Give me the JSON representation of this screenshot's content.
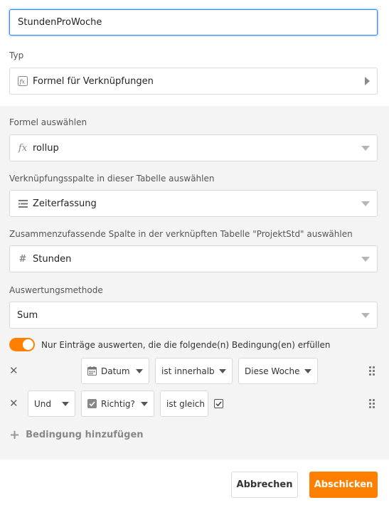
{
  "column_name": {
    "value": "StundenProWoche"
  },
  "type": {
    "label": "Typ",
    "value": "Formel für Verknüpfungen",
    "icon": "fx-icon"
  },
  "formula": {
    "label": "Formel auswählen",
    "value": "rollup",
    "icon": "fx-icon"
  },
  "link_column": {
    "label": "Verknüpfungsspalte in dieser Tabelle auswählen",
    "value": "Zeiterfassung",
    "icon": "link-list-icon"
  },
  "summary_column": {
    "label": "Zusammenzufassende Spalte in der verknüpften Tabelle \"ProjektStd\" auswählen",
    "value": "Stunden",
    "icon": "hash-icon"
  },
  "method": {
    "label": "Auswertungsmethode",
    "value": "Sum"
  },
  "filter_toggle": {
    "label": "Nur Einträge auswerten, die die folgende(n) Bedingung(en) erfüllen",
    "on": true
  },
  "conditions": [
    {
      "column": "Datum",
      "column_icon": "calendar-icon",
      "operator": "ist innerhalb",
      "value": "Diese Woche"
    },
    {
      "conjunction": "Und",
      "column": "Richtig?",
      "column_icon": "checkbox-icon",
      "operator": "ist gleich",
      "checked": true
    }
  ],
  "add_condition": {
    "label": "Bedingung hinzufügen"
  },
  "footer": {
    "cancel_label": "Abbrechen",
    "submit_label": "Abschicken"
  },
  "colors": {
    "accent": "#ff8000",
    "focus": "#2d7ff9",
    "panel": "#f4f4f4"
  }
}
